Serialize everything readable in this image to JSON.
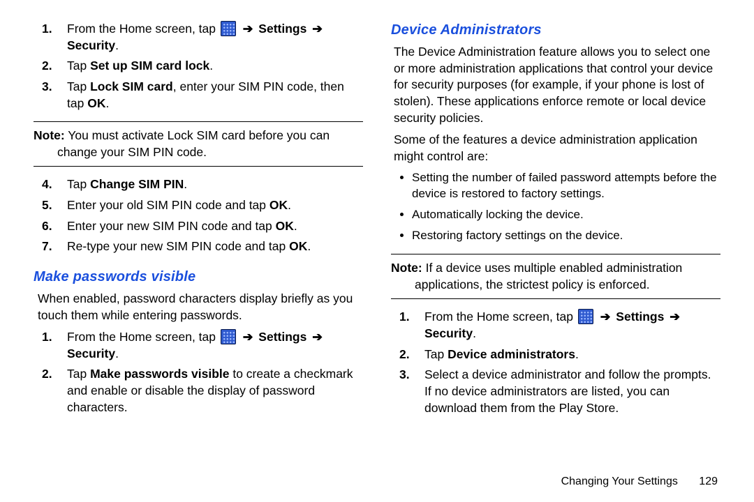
{
  "left": {
    "steps_a": [
      {
        "pre": "From the Home screen, tap ",
        "post1": "Settings",
        "post2": "Security",
        "tail": "."
      },
      {
        "pre": "Tap ",
        "bold": "Set up SIM card lock",
        "tail": "."
      },
      {
        "pre": "Tap ",
        "bold": "Lock SIM card",
        "mid": ", enter your SIM PIN code, then tap ",
        "bold2": "OK",
        "tail": "."
      }
    ],
    "note": {
      "label": "Note:",
      "text": " You must activate Lock SIM card before you can change your SIM PIN code."
    },
    "steps_b": [
      {
        "pre": "Tap ",
        "bold": "Change SIM PIN",
        "tail": "."
      },
      {
        "pre": "Enter your old SIM PIN code and tap ",
        "bold": "OK",
        "tail": "."
      },
      {
        "pre": "Enter your new SIM PIN code and tap ",
        "bold": "OK",
        "tail": "."
      },
      {
        "pre": "Re-type your new SIM PIN code and tap ",
        "bold": "OK",
        "tail": "."
      }
    ],
    "heading": "Make passwords visible",
    "para": "When enabled, password characters display briefly as you touch them while entering passwords.",
    "steps_c": [
      {
        "pre": "From the Home screen, tap ",
        "post1": "Settings",
        "post2": "Security",
        "tail": "."
      },
      {
        "pre": "Tap ",
        "bold": "Make passwords visible",
        "mid": " to create a checkmark and enable or disable the display of password characters.",
        "tail": ""
      }
    ]
  },
  "right": {
    "heading": "Device Administrators",
    "para1": "The Device Administration feature allows you to select one or more administration applications that control your device for security purposes (for example, if your phone is lost of stolen). These applications enforce remote or local device security policies.",
    "para2": "Some of the features a device administration application might control are:",
    "bullets": [
      "Setting the number of failed password attempts before the device is restored to factory settings.",
      "Automatically locking the device.",
      "Restoring factory settings on the device."
    ],
    "note": {
      "label": "Note:",
      "text": " If a device uses multiple enabled administration applications, the strictest policy is enforced."
    },
    "steps": [
      {
        "pre": "From the Home screen, tap ",
        "post1": "Settings",
        "post2": "Security",
        "tail": "."
      },
      {
        "pre": "Tap ",
        "bold": "Device administrators",
        "tail": "."
      },
      {
        "pre": "Select a device administrator and follow the prompts. If no device administrators are listed, you can download them from the Play Store.",
        "tail": ""
      }
    ]
  },
  "footer": {
    "section": "Changing Your Settings",
    "page": "129"
  },
  "arrow": "➔"
}
